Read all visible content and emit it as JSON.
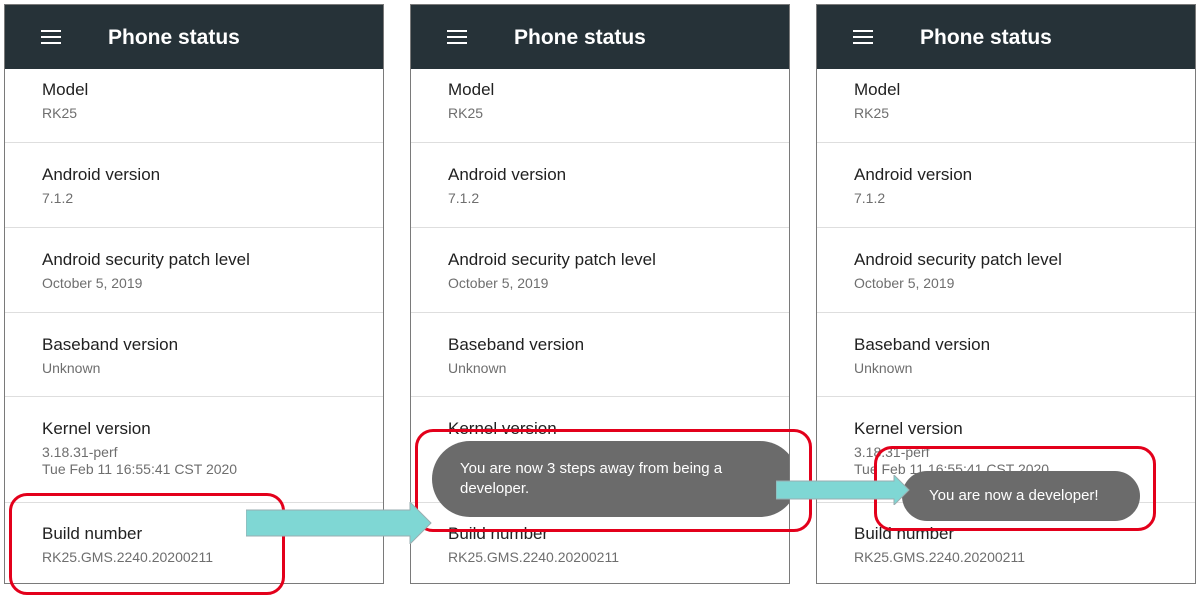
{
  "appbar": {
    "title": "Phone status",
    "menu_icon": "hamburger-menu-icon"
  },
  "rows": [
    {
      "label": "Model",
      "value": "RK25"
    },
    {
      "label": "Android version",
      "value": "7.1.2"
    },
    {
      "label": "Android security patch level",
      "value": "October 5, 2019"
    },
    {
      "label": "Baseband version",
      "value": "Unknown"
    },
    {
      "label": "Kernel version",
      "value": "3.18.31-perf",
      "value2": "Tue Feb 11 16:55:41 CST 2020"
    },
    {
      "label": "Build number",
      "value": "RK25.GMS.2240.20200211"
    }
  ],
  "toasts": {
    "steps_away": "You are now 3 steps away from being a developer.",
    "developer": "You are now a developer!"
  },
  "colors": {
    "appbar": "#263238",
    "toast": "#6b6b6b",
    "highlight": "#e3001b",
    "arrow": "#7fd7d4"
  }
}
